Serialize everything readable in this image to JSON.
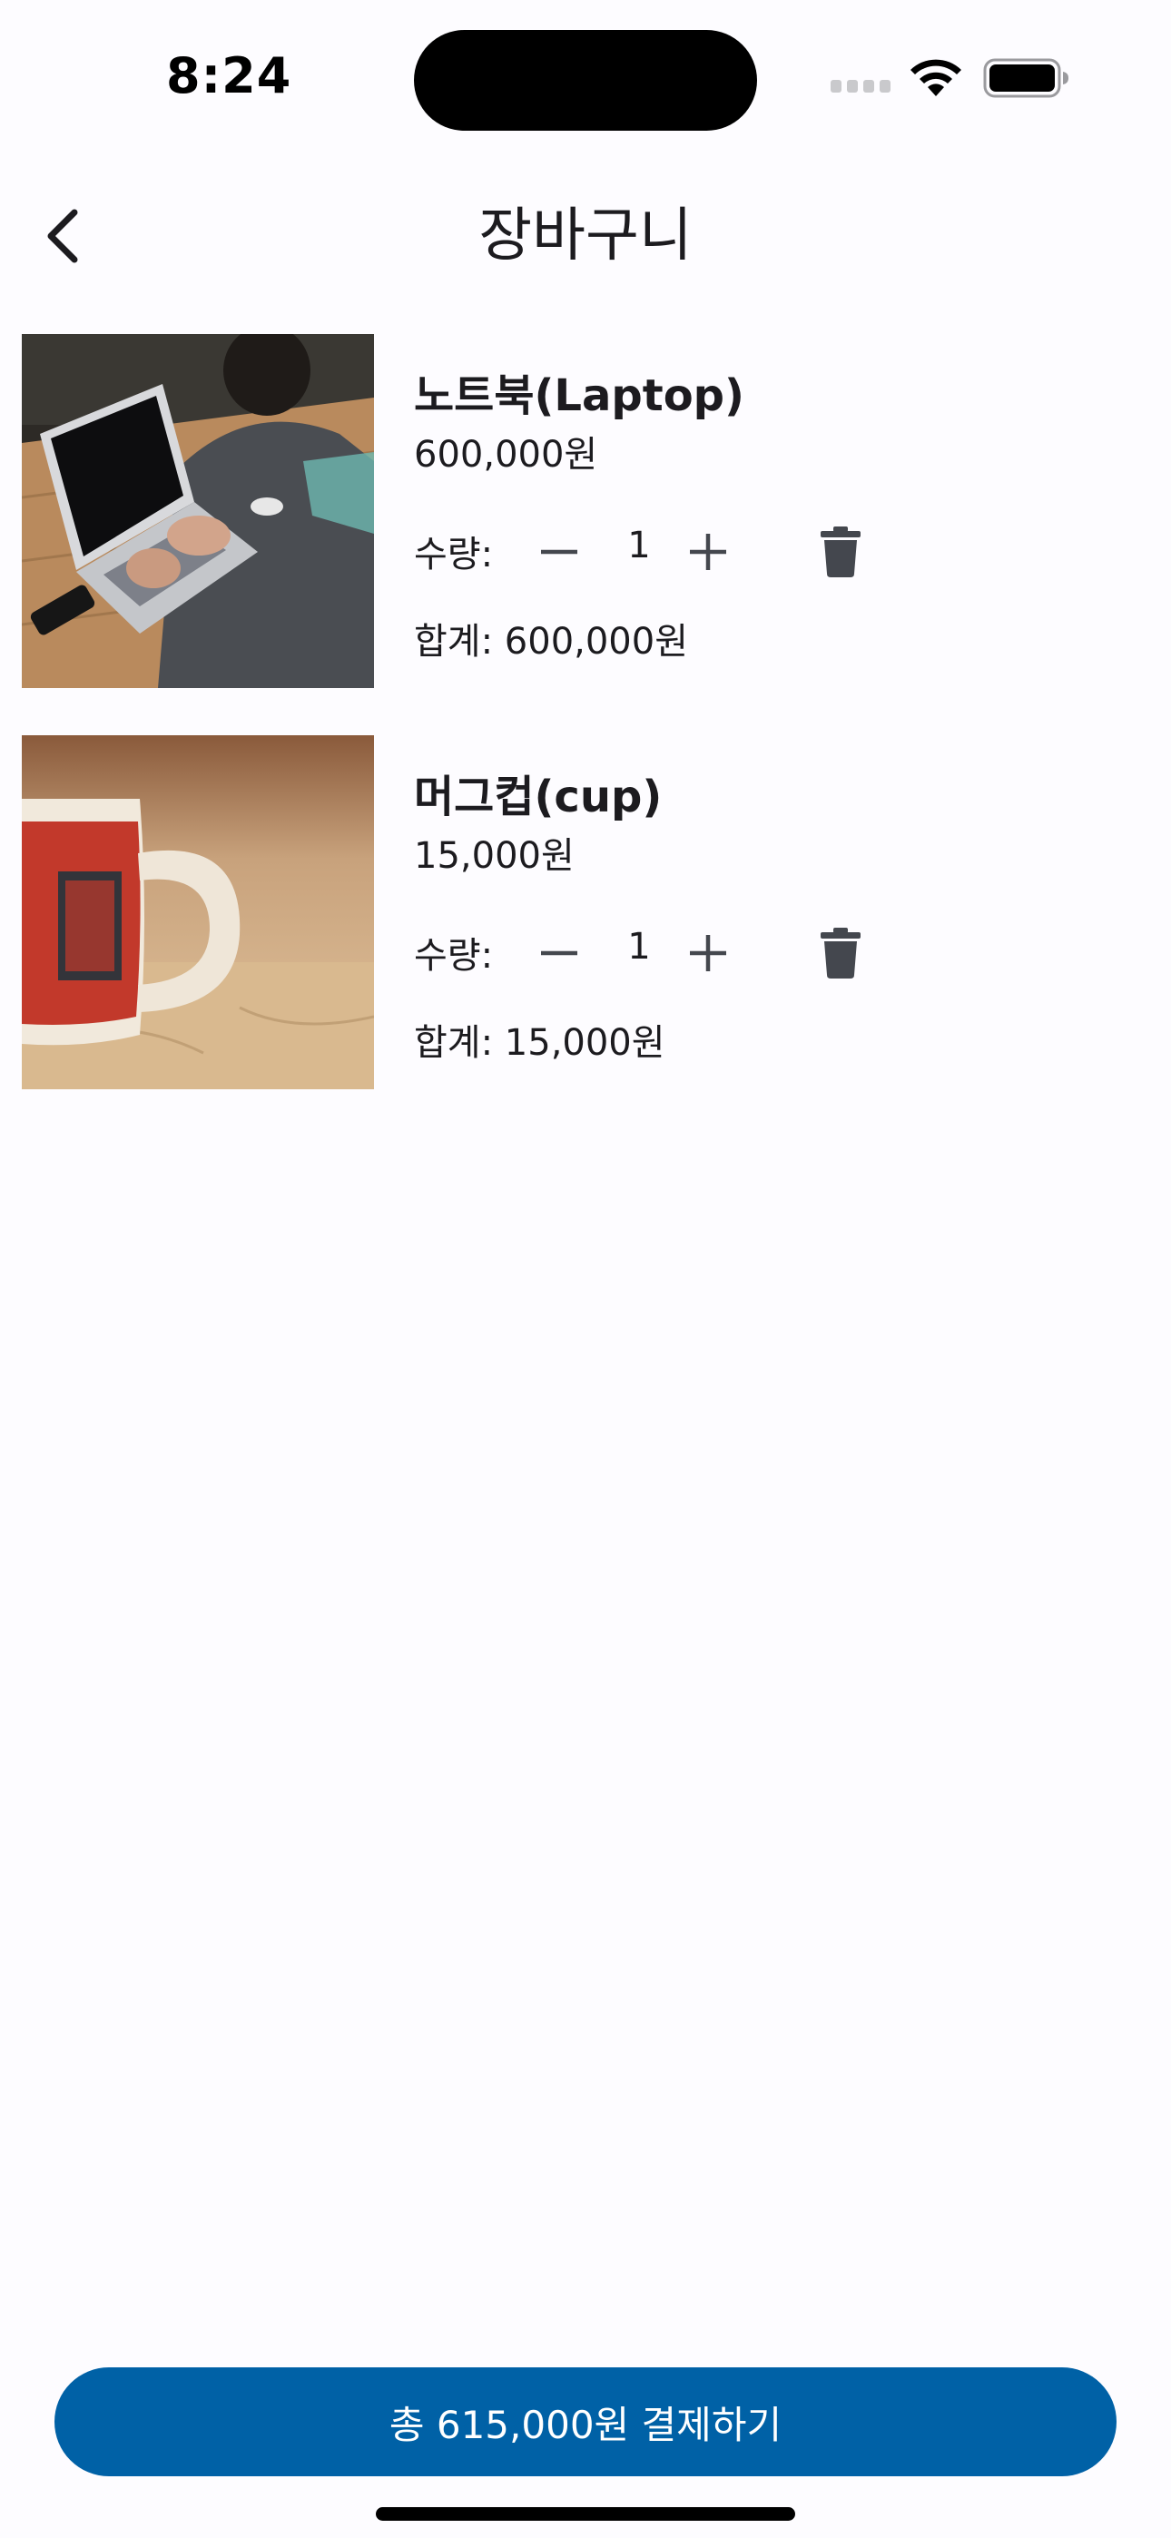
{
  "status_bar": {
    "time": "8:24"
  },
  "app_bar": {
    "title": "장바구니"
  },
  "cart": {
    "qty_label": "수량:",
    "items": [
      {
        "name": "노트북(Laptop)",
        "price": "600,000원",
        "quantity": "1",
        "subtotal": "합계: 600,000원",
        "image": "laptop-photo"
      },
      {
        "name": "머그컵(cup)",
        "price": "15,000원",
        "quantity": "1",
        "subtotal": "합계: 15,000원",
        "image": "mug-photo"
      }
    ]
  },
  "checkout": {
    "label": "총 615,000원 결제하기"
  },
  "colors": {
    "primary": "#0061a6",
    "background": "#fdfcff",
    "icon": "#44474e"
  }
}
